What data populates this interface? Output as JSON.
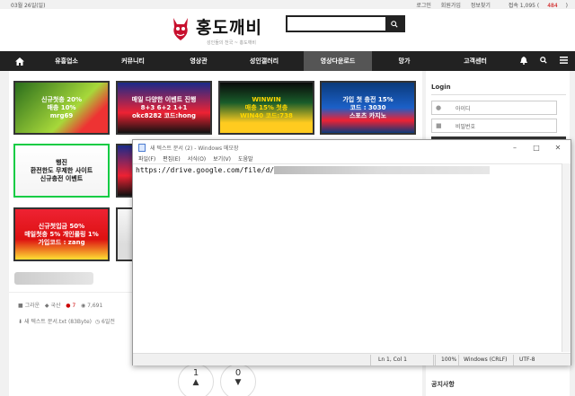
{
  "topbar": {
    "date": "03월 26일(일)",
    "links": [
      "로그인",
      "회원가입",
      "정보찾기"
    ],
    "visitors_label": "접속 1,095 (",
    "visitors_count": "484",
    "visitors_close": ")"
  },
  "header": {
    "logo_text": "홍도깨비",
    "tagline": "성인들의 천국 ~ 홍도깨비"
  },
  "nav": {
    "items": [
      {
        "label": "유흥업소"
      },
      {
        "label": "커뮤니티"
      },
      {
        "label": "영상관"
      },
      {
        "label": "성인갤러리"
      },
      {
        "label": "영상다운로드"
      },
      {
        "label": "망가"
      },
      {
        "label": "고객센터"
      }
    ]
  },
  "banners": [
    {
      "line1": "신규첫충 20%",
      "line2": "매충 10%",
      "line3": "mrg69"
    },
    {
      "line1": "매일 다양한 이벤트 진행",
      "line2": "8+3 6+2 1+1",
      "line3": "okc8282 코드:hong"
    },
    {
      "line1": "WINWIN",
      "line2": "매충 15% 첫충",
      "line3": "WIN40 코드:738"
    },
    {
      "line1": "가입 첫 충전 15%",
      "line2": "코드 : 3030",
      "line3": "스포츠 카지노"
    },
    {
      "line1": "행진",
      "line2": "환전한도 무제한 사이트",
      "line3": "신규충전 이벤트"
    },
    {
      "line1": "신규첫입금 50%",
      "line2": "매일첫충 5% 개인롤링 1%",
      "line3": "가입코드 : zang"
    },
    {
      "line1": "",
      "line2": "",
      "line3": ""
    }
  ],
  "post_meta": {
    "author": "그라운",
    "category": "국산",
    "comments": "7",
    "views": "7,691",
    "attachment": "새 텍스트 문서.txt (83Byte)",
    "date": "6일전"
  },
  "votes": {
    "up": "1",
    "down": "0"
  },
  "sidebar": {
    "login_title": "Login",
    "id_placeholder": "아이디",
    "pw_placeholder": "비밀번호",
    "notice_title": "공지사항"
  },
  "notepad": {
    "title": "새 텍스트 문서 (2) - Windows 메모장",
    "menu": [
      "파일(F)",
      "편집(E)",
      "서식(O)",
      "보기(V)",
      "도움말"
    ],
    "content": "https://drive.google.com/file/d/",
    "status": {
      "position": "Ln 1, Col 1",
      "zoom": "100%",
      "eol": "Windows (CRLF)",
      "encoding": "UTF-8"
    }
  },
  "colors": {
    "nav_bg": "#222222",
    "accent_red": "#cc0000"
  }
}
